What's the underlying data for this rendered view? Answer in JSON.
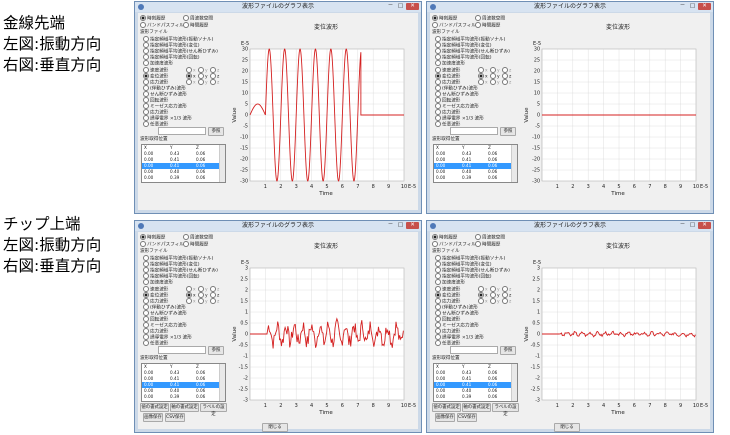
{
  "captions": [
    {
      "lines": [
        "金線先端",
        "左図:振動方向",
        "右図:垂直方向"
      ]
    },
    {
      "lines": [
        "チップ上端",
        "左図:振動方向",
        "右図:垂直方向"
      ]
    }
  ],
  "colors": {
    "trace": "#d42020",
    "window_border": "#6f8fb5",
    "window_title": "#d7e3f1",
    "close_button": "#c7504b",
    "selection": "#3399ff"
  },
  "windows": [
    {
      "title": "波形ファイルのグラフ表示",
      "controls": {
        "minimize": "－",
        "maximize": "□",
        "close": "✕"
      },
      "mode": {
        "time_history": "時刻履歴",
        "spatial_distribution": "周波数空間",
        "bandpass_filter": "バンドパスフィルタ",
        "time_history_rec": "時間履歴"
      },
      "file_group": "波形ファイル",
      "file_types": [
        "指定頻域平均波形(振動ソナル)",
        "指定頻域平均波形(変位)",
        "指定頻域平均波形(せん断ひずみ)",
        "指定頻域平均波形(回転)",
        "加速度波形"
      ],
      "quantities": [
        "速度波形",
        "変位波形",
        "応力波形",
        "(伴動ひずみ)波形",
        "せん断ひずみ波形",
        "回転波形",
        "ミーゼス応力波形",
        "応力波形",
        "誘導電界 ×1/3 波形",
        "任意波形"
      ],
      "xyz": [
        "x",
        "y",
        "z"
      ],
      "ref_button": "参照",
      "table_title": "波形取得位置",
      "columns": [
        "X",
        "Y",
        "Z"
      ],
      "rows": [
        [
          "0.00",
          "0.43",
          "0.06"
        ],
        [
          "0.00",
          "0.41",
          "0.06"
        ],
        [
          "0.00",
          "0.41",
          "0.06"
        ],
        [
          "0.00",
          "0.40",
          "0.06"
        ],
        [
          "0.00",
          "0.39",
          "0.06"
        ]
      ],
      "bottom": null,
      "chart_data": {
        "type": "line",
        "title": "変位波形",
        "xlabel": "Time",
        "ylabel": "Value",
        "x_unit": "E-5",
        "y_unit": "E-5",
        "xlim": [
          0,
          10
        ],
        "ylim": [
          -30,
          30
        ],
        "xticks": [
          1,
          2,
          3,
          4,
          5,
          6,
          7,
          8,
          9,
          10
        ],
        "yticks": [
          -30,
          -25,
          -20,
          -15,
          -10,
          -5,
          0,
          5,
          10,
          15,
          20,
          25,
          30
        ],
        "series": [
          {
            "kind": "sine",
            "amplitude": 30,
            "period": 1,
            "start": 1,
            "end": 7.2,
            "pre_bump": 5,
            "after": 0
          }
        ]
      }
    },
    {
      "title": "波形ファイルのグラフ表示",
      "controls": {
        "minimize": "－",
        "maximize": "□",
        "close": "✕"
      },
      "mode": {
        "time_history": "時刻履歴",
        "spatial_distribution": "周波数空間",
        "bandpass_filter": "バンドパスフィルタ",
        "time_history_rec": "時間履歴"
      },
      "file_group": "波形ファイル",
      "file_types": [
        "指定頻域平均波形(振動ソナル)",
        "指定頻域平均波形(変位)",
        "指定頻域平均波形(せん断ひずみ)",
        "指定頻域平均波形(回転)",
        "加速度波形"
      ],
      "quantities": [
        "速度波形",
        "変位波形",
        "応力波形",
        "(伴動ひずみ)波形",
        "せん断ひずみ波形",
        "回転波形",
        "ミーゼス応力波形",
        "応力波形",
        "誘導電界 ×1/3 波形",
        "任意波形"
      ],
      "xyz": [
        "x",
        "y",
        "z"
      ],
      "ref_button": "参照",
      "table_title": "波形取得位置",
      "columns": [
        "X",
        "Y",
        "Z"
      ],
      "rows": [
        [
          "0.00",
          "0.43",
          "0.06"
        ],
        [
          "0.00",
          "0.41",
          "0.06"
        ],
        [
          "0.00",
          "0.41",
          "0.06"
        ],
        [
          "0.00",
          "0.40",
          "0.06"
        ],
        [
          "0.00",
          "0.39",
          "0.06"
        ]
      ],
      "bottom": null,
      "chart_data": {
        "type": "line",
        "title": "変位波形",
        "xlabel": "Time",
        "ylabel": "Value",
        "x_unit": "E-5",
        "y_unit": "E-5",
        "xlim": [
          0,
          10
        ],
        "ylim": [
          -30,
          30
        ],
        "xticks": [
          1,
          2,
          3,
          4,
          5,
          6,
          7,
          8,
          9,
          10
        ],
        "yticks": [
          -30,
          -25,
          -20,
          -15,
          -10,
          -5,
          0,
          5,
          10,
          15,
          20,
          25,
          30
        ],
        "series": [
          {
            "kind": "flat",
            "value": 0
          }
        ]
      }
    },
    {
      "title": "波形ファイルのグラフ表示",
      "controls": {
        "minimize": "－",
        "maximize": "□",
        "close": "✕"
      },
      "mode": {
        "time_history": "時刻履歴",
        "spatial_distribution": "周波数空間",
        "bandpass_filter": "バンドパスフィルタ",
        "time_history_rec": "時間履歴"
      },
      "file_group": "波形ファイル",
      "file_types": [
        "指定頻域平均波形(振動ソナル)",
        "指定頻域平均波形(変位)",
        "指定頻域平均波形(せん断ひずみ)",
        "指定頻域平均波形(回転)",
        "加速度波形"
      ],
      "quantities": [
        "速度波形",
        "変位波形",
        "応力波形",
        "(伴動ひずみ)波形",
        "せん断ひずみ波形",
        "回転波形",
        "ミーゼス応力波形",
        "応力波形",
        "誘導電界 ×1/3 波形",
        "任意波形"
      ],
      "xyz": [
        "x",
        "y",
        "z"
      ],
      "ref_button": "参照",
      "table_title": "波形取得位置",
      "columns": [
        "X",
        "Y",
        "Z"
      ],
      "rows": [
        [
          "0.00",
          "0.43",
          "0.06"
        ],
        [
          "0.00",
          "0.41",
          "0.06"
        ],
        [
          "0.00",
          "0.41",
          "0.06"
        ],
        [
          "0.00",
          "0.40",
          "0.06"
        ],
        [
          "0.00",
          "0.39",
          "0.06"
        ]
      ],
      "bottom": {
        "axis_settings": "値の書式設定",
        "axis_format": "軸の書式設定",
        "label_settings": "ラベルの設定",
        "save_image": "画像保存",
        "save_csv": "CSV保存",
        "close": "閉じる"
      },
      "chart_data": {
        "type": "line",
        "title": "変位波形",
        "xlabel": "Time",
        "ylabel": "Value",
        "x_unit": "E-5",
        "y_unit": "E-5",
        "xlim": [
          0,
          10
        ],
        "ylim": [
          -3,
          3
        ],
        "xticks": [
          1,
          2,
          3,
          4,
          5,
          6,
          7,
          8,
          9,
          10
        ],
        "yticks": [
          -3,
          -2.5,
          -2,
          -1.5,
          -1,
          -0.5,
          0,
          0.5,
          1,
          1.5,
          2,
          2.5,
          3
        ],
        "series": [
          {
            "kind": "noise",
            "start": 1.2,
            "amplitude": 0.55,
            "period": 0.55,
            "seed": 7
          }
        ]
      }
    },
    {
      "title": "波形ファイルのグラフ表示",
      "controls": {
        "minimize": "－",
        "maximize": "□",
        "close": "✕"
      },
      "mode": {
        "time_history": "時刻履歴",
        "spatial_distribution": "周波数空間",
        "bandpass_filter": "バンドパスフィルタ",
        "time_history_rec": "時間履歴"
      },
      "file_group": "波形ファイル",
      "file_types": [
        "指定頻域平均波形(振動ソナル)",
        "指定頻域平均波形(変位)",
        "指定頻域平均波形(せん断ひずみ)",
        "指定頻域平均波形(回転)",
        "加速度波形"
      ],
      "quantities": [
        "速度波形",
        "変位波形",
        "応力波形",
        "(伴動ひずみ)波形",
        "せん断ひずみ波形",
        "回転波形",
        "ミーゼス応力波形",
        "応力波形",
        "誘導電界 ×1/3 波形",
        "任意波形"
      ],
      "xyz": [
        "x",
        "y",
        "z"
      ],
      "ref_button": "参照",
      "table_title": "波形取得位置",
      "columns": [
        "X",
        "Y",
        "Z"
      ],
      "rows": [
        [
          "0.00",
          "0.43",
          "0.06"
        ],
        [
          "0.00",
          "0.41",
          "0.06"
        ],
        [
          "0.00",
          "0.41",
          "0.06"
        ],
        [
          "0.00",
          "0.40",
          "0.06"
        ],
        [
          "0.00",
          "0.39",
          "0.06"
        ]
      ],
      "bottom": {
        "axis_settings": "値の書式設定",
        "axis_format": "軸の書式設定",
        "label_settings": "ラベルの設定",
        "save_image": "画像保存",
        "save_csv": "CSV保存",
        "close": "閉じる"
      },
      "chart_data": {
        "type": "line",
        "title": "変位波形",
        "xlabel": "Time",
        "ylabel": "Value",
        "x_unit": "E-5",
        "y_unit": "E-5",
        "xlim": [
          0,
          10
        ],
        "ylim": [
          -3,
          3
        ],
        "xticks": [
          1,
          2,
          3,
          4,
          5,
          6,
          7,
          8,
          9,
          10
        ],
        "yticks": [
          -3,
          -2.5,
          -2,
          -1.5,
          -1,
          -0.5,
          0,
          0.5,
          1,
          1.5,
          2,
          2.5,
          3
        ],
        "series": [
          {
            "kind": "noise",
            "start": 1.2,
            "amplitude": 0.1,
            "period": 0.5,
            "seed": 3
          }
        ]
      }
    }
  ]
}
